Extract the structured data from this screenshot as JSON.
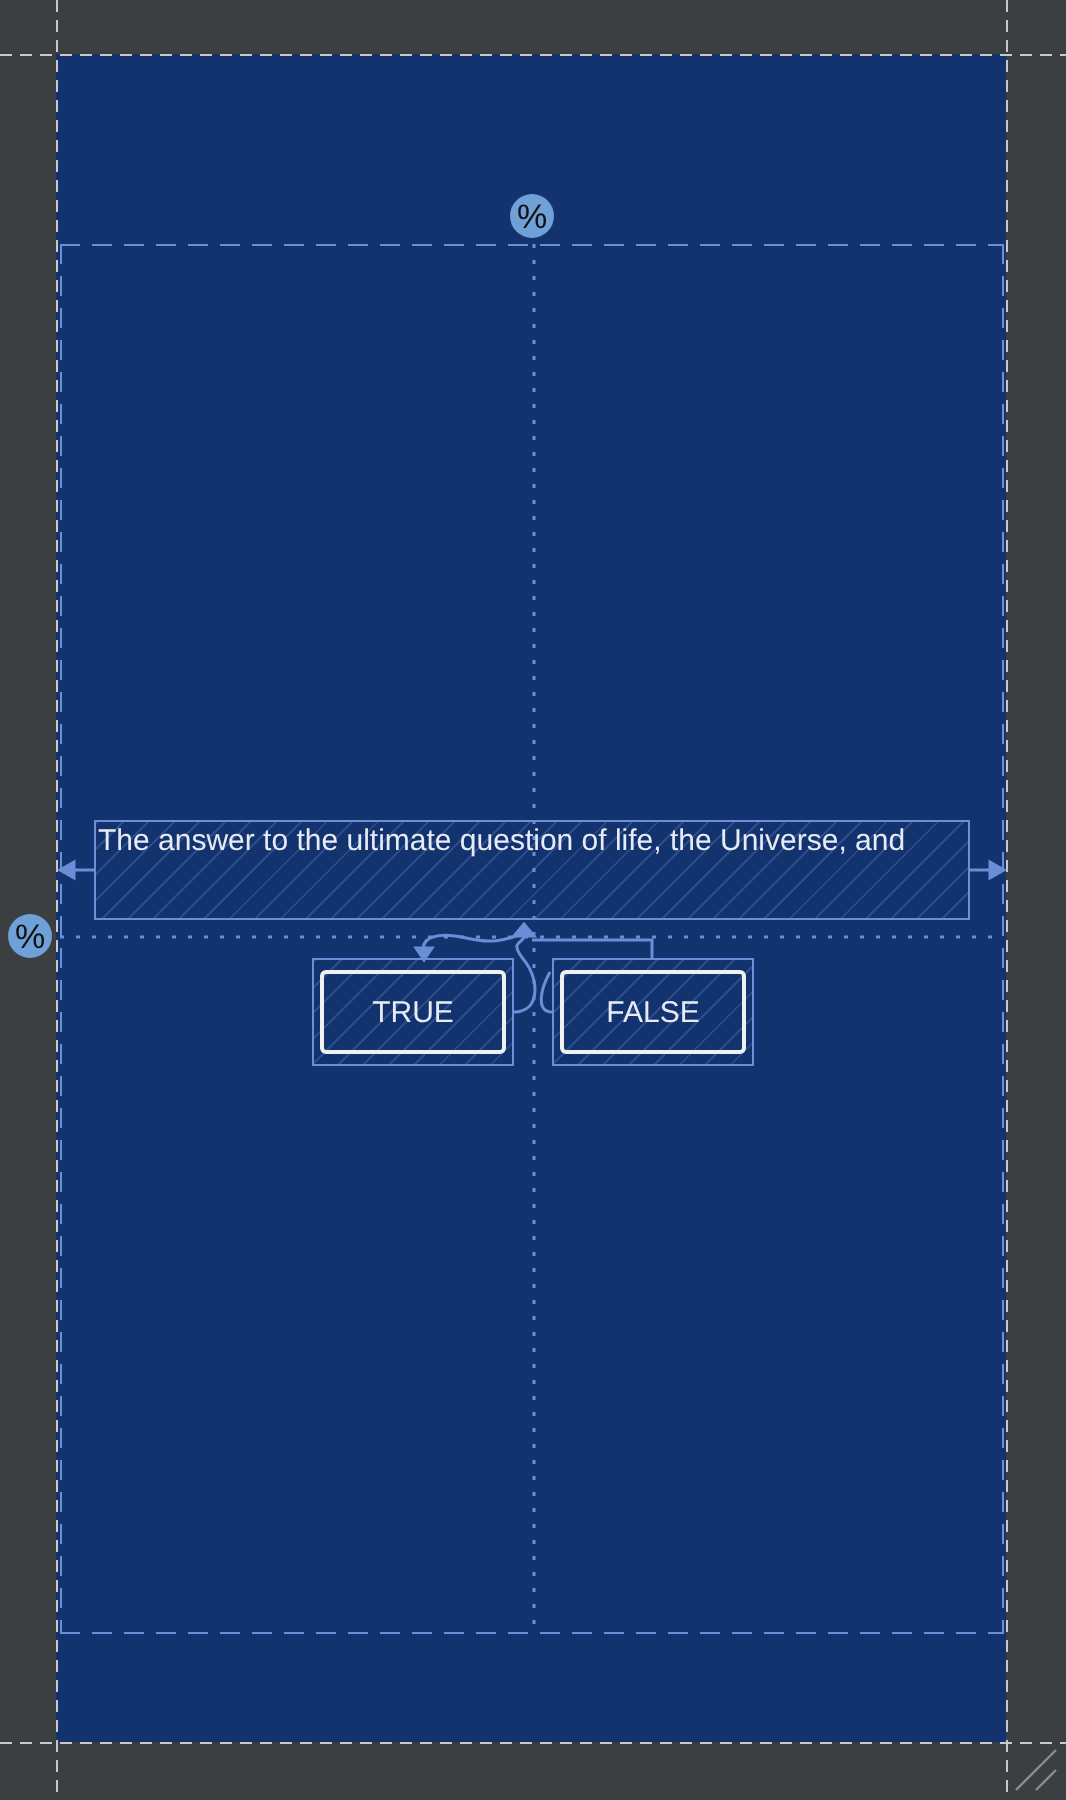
{
  "vertical_guideline": {
    "badge": "%"
  },
  "horizontal_guideline": {
    "badge": "%"
  },
  "text_view": {
    "text": "The answer to the ultimate question of life, the Universe, and"
  },
  "buttons": [
    {
      "label": "TRUE"
    },
    {
      "label": "FALSE"
    }
  ]
}
